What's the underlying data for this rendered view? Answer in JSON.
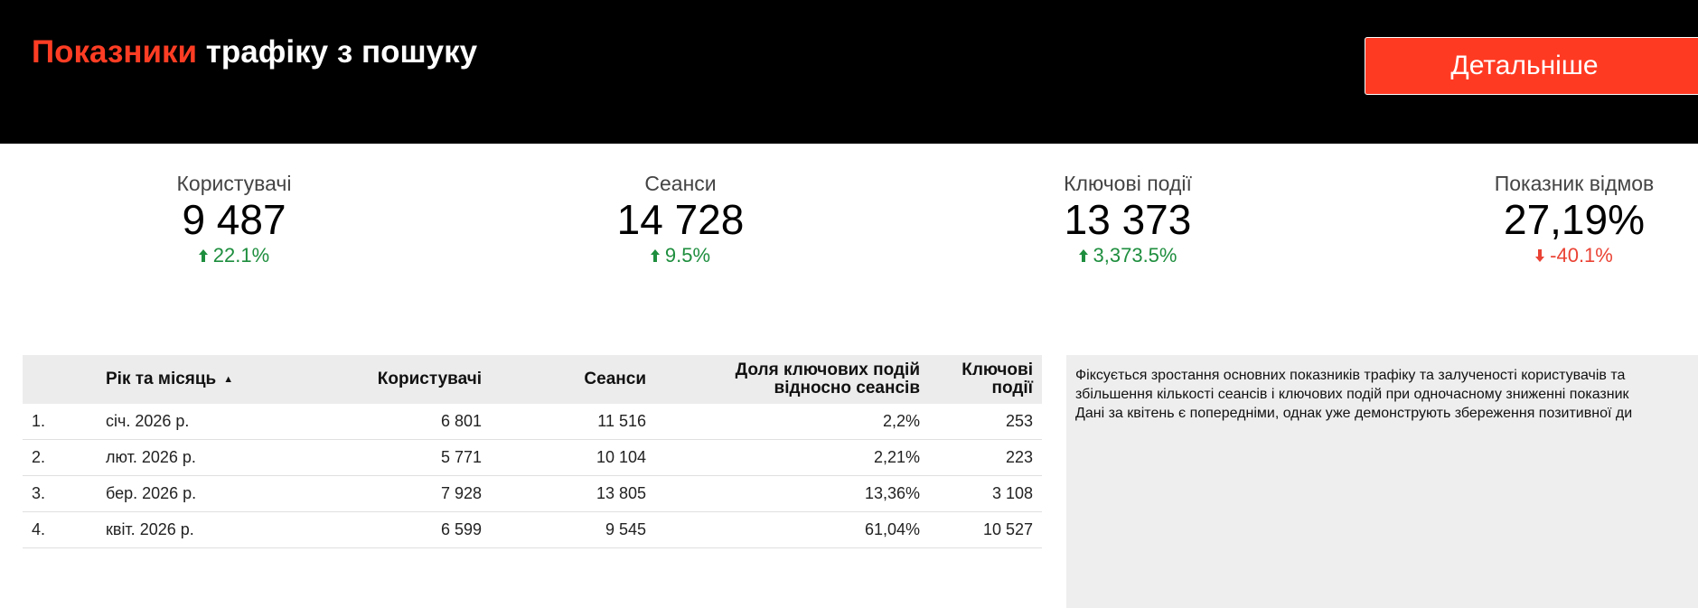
{
  "header": {
    "title_accent": "Показники",
    "title_rest": "трафіку з пошуку",
    "details_button": "Детальніше"
  },
  "kpis": [
    {
      "label": "Користувачі",
      "value": "9 487",
      "delta": "22.1%",
      "direction": "up"
    },
    {
      "label": "Сеанси",
      "value": "14 728",
      "delta": "9.5%",
      "direction": "up"
    },
    {
      "label": "Ключові події",
      "value": "13 373",
      "delta": "3,373.5%",
      "direction": "up"
    },
    {
      "label": "Показник відмов",
      "value": "27,19%",
      "delta": "-40.1%",
      "direction": "down"
    }
  ],
  "table": {
    "headers": {
      "month": "Рік та місяць",
      "users": "Користувачі",
      "sessions": "Сеанси",
      "share_line1": "Доля ключових подій",
      "share_line2": "відносно сеансів",
      "events_line1": "Ключові",
      "events_line2": "події"
    },
    "rows": [
      {
        "idx": "1.",
        "month": "січ. 2026 р.",
        "users": "6 801",
        "sessions": "11 516",
        "share": "2,2%",
        "events": "253"
      },
      {
        "idx": "2.",
        "month": "лют. 2026 р.",
        "users": "5 771",
        "sessions": "10 104",
        "share": "2,21%",
        "events": "223"
      },
      {
        "idx": "3.",
        "month": "бер. 2026 р.",
        "users": "7 928",
        "sessions": "13 805",
        "share": "13,36%",
        "events": "3 108"
      },
      {
        "idx": "4.",
        "month": "квіт. 2026 р.",
        "users": "6 599",
        "sessions": "9 545",
        "share": "61,04%",
        "events": "10 527"
      }
    ]
  },
  "note": {
    "line1": "Фіксується зростання основних показників трафіку та залученості користувачів та",
    "line2": "збільшення кількості сеансів і ключових подій при одночасному зниженні показник",
    "line3": "Дані за квітень є попередніми, однак уже демонструють збереження позитивної ди"
  },
  "colors": {
    "accent": "#ff3d24",
    "positive": "#1e8e3e",
    "negative": "#ea4335"
  }
}
